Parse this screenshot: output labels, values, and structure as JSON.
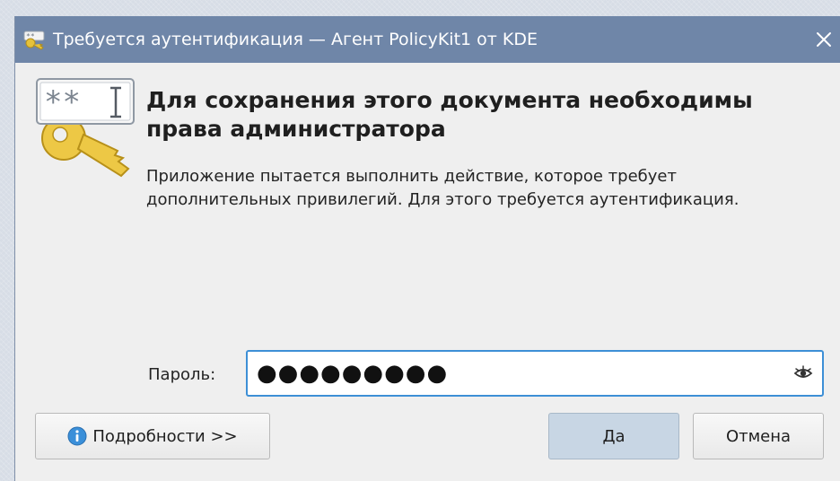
{
  "window": {
    "title": "Требуется аутентификация — Агент PolicyKit1 от KDE"
  },
  "dialog": {
    "heading": "Для сохранения этого документа необходимы права администратора",
    "description": "Приложение пытается выполнить действие, которое требует дополнительных привилегий. Для этого требуется аутентификация.",
    "password_label": "Пароль:",
    "password_value": "●●●●●●●●●"
  },
  "buttons": {
    "details": "Подробности >>",
    "yes": "Да",
    "cancel": "Отмена"
  },
  "icons": {
    "title": "keys-icon",
    "dialog": "password-keys-icon",
    "password_visibility": "eye-icon",
    "details": "info-icon",
    "close": "close-icon"
  },
  "colors": {
    "titlebar": "#6f86a8",
    "focus_border": "#3d8fd6",
    "default_button": "#c8d6e4"
  }
}
